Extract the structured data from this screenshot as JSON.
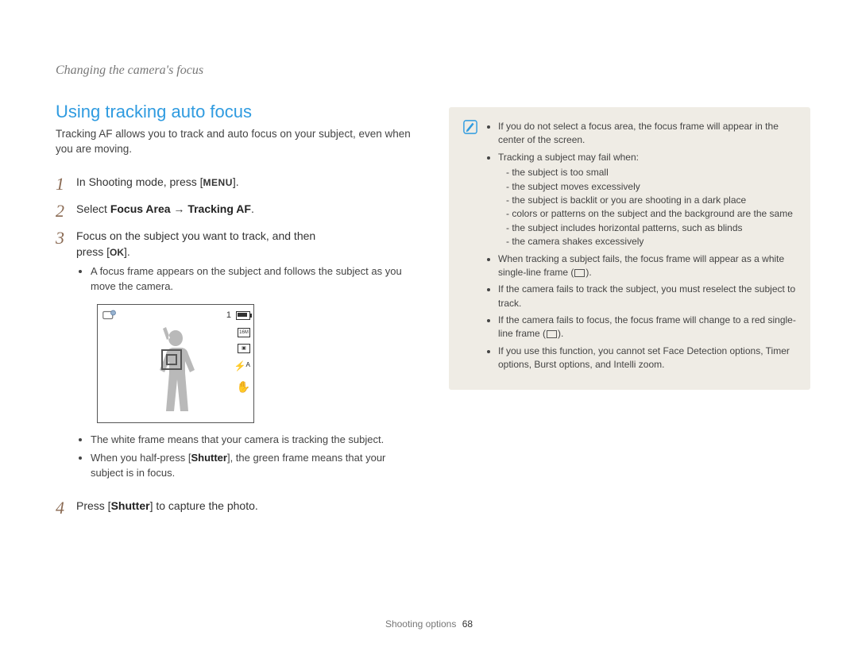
{
  "breadcrumb": "Changing the camera's focus",
  "heading": "Using tracking auto focus",
  "intro": "Tracking AF allows you to track and auto focus on your subject, even when you are moving.",
  "steps": {
    "s1_pre": "In Shooting mode, press [",
    "s1_btn": "MENU",
    "s1_post": "].",
    "s2_pre": "Select ",
    "s2_b1": "Focus Area",
    "s2_arrow": " → ",
    "s2_b2": "Tracking AF",
    "s2_post": ".",
    "s3_line1": "Focus on the subject you want to track, and then",
    "s3_line2_pre": "press [",
    "s3_btn": "OK",
    "s3_line2_post": "].",
    "s3_sub1": "A focus frame appears on the subject and follows the subject as you move the camera.",
    "s3_sub2": "The white frame means that your camera is tracking the subject.",
    "s3_sub3_pre": "When you half-press [",
    "s3_sub3_b": "Shutter",
    "s3_sub3_post": "], the green frame means that your subject is in focus.",
    "s4_pre": "Press [",
    "s4_b": "Shutter",
    "s4_post": "] to capture the photo."
  },
  "step_numbers": {
    "n1": "1",
    "n2": "2",
    "n3": "3",
    "n4": "4"
  },
  "screen": {
    "top_number": "1",
    "size_label": "16M"
  },
  "notes": {
    "n1": "If you do not select a focus area, the focus frame will appear in the center of the screen.",
    "n2": "Tracking a subject may fail when:",
    "n2a": "the subject is too small",
    "n2b": "the subject moves excessively",
    "n2c": "the subject is backlit or you are shooting in a dark place",
    "n2d": "colors or patterns on the subject and the background are the same",
    "n2e": "the subject includes horizontal patterns, such as blinds",
    "n2f": "the camera shakes excessively",
    "n3_pre": "When tracking a subject fails, the focus frame will appear as a white single-line frame (",
    "n3_post": ").",
    "n4": "If the camera fails to track the subject, you must reselect the subject to track.",
    "n5_pre": "If the camera fails to focus, the focus frame will change to a red single-line frame (",
    "n5_post": ").",
    "n6": "If you use this function, you cannot set Face Detection options, Timer options, Burst options, and Intelli zoom."
  },
  "footer": {
    "section": "Shooting options",
    "page": "68"
  }
}
